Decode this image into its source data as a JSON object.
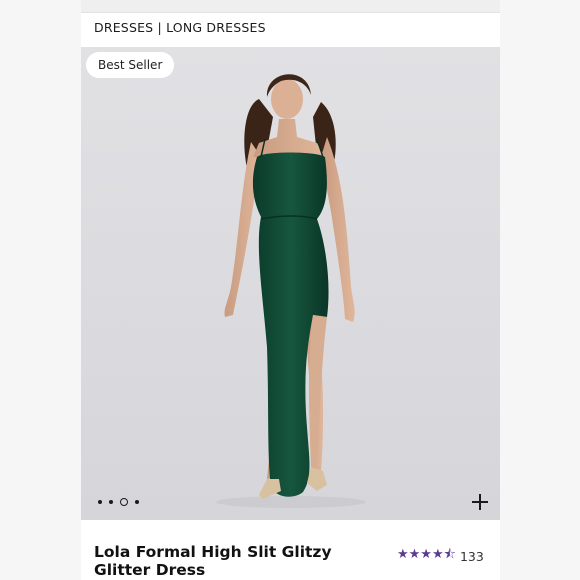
{
  "breadcrumb": {
    "text": "DRESSES | LONG DRESSES"
  },
  "gallery": {
    "badge": "Best Seller",
    "current_slide": 3,
    "total_slides": 4
  },
  "product": {
    "title": "Lola Formal High Slit Glitzy Glitter Dress",
    "rating": 4.5,
    "stars": "★★★★⯪",
    "review_count": "133"
  },
  "colors": {
    "dress": "#0f4a35",
    "stars": "#5b3c8f",
    "backdrop": "#dcdce0"
  },
  "icons": {
    "zoom": "plus-icon"
  }
}
